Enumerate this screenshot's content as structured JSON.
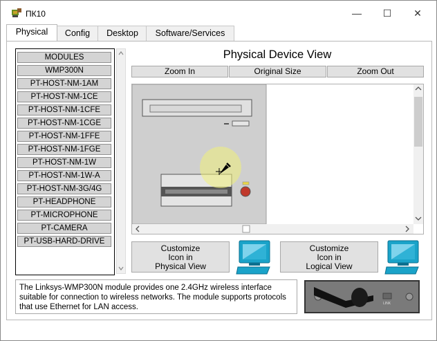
{
  "window": {
    "title": "ПК10",
    "minimize": "—",
    "maximize": "☐",
    "close": "✕"
  },
  "tabs": [
    {
      "label": "Physical",
      "active": true
    },
    {
      "label": "Config"
    },
    {
      "label": "Desktop"
    },
    {
      "label": "Software/Services"
    }
  ],
  "modules": {
    "items": [
      "MODULES",
      "WMP300N",
      "PT-HOST-NM-1AM",
      "PT-HOST-NM-1CE",
      "PT-HOST-NM-1CFE",
      "PT-HOST-NM-1CGE",
      "PT-HOST-NM-1FFE",
      "PT-HOST-NM-1FGE",
      "PT-HOST-NM-1W",
      "PT-HOST-NM-1W-A",
      "PT-HOST-NM-3G/4G",
      "PT-HEADPHONE",
      "PT-MICROPHONE",
      "PT-CAMERA",
      "PT-USB-HARD-DRIVE"
    ]
  },
  "physical_view": {
    "title": "Physical Device View",
    "zoom_in": "Zoom In",
    "original_size": "Original Size",
    "zoom_out": "Zoom Out"
  },
  "customize": {
    "physical_label": "Customize\nIcon in\nPhysical View",
    "logical_label": "Customize\nIcon in\nLogical View"
  },
  "description": "The Linksys-WMP300N module provides one 2.4GHz wireless interface suitable for connection to wireless networks. The module supports protocols that use Ethernet for LAN access.",
  "module_image": {
    "port_label": "LINK"
  },
  "colors": {
    "button": "#e1e1e1",
    "module_item": "#d4d4d4",
    "monitor_teal": "#1aa3c9"
  }
}
